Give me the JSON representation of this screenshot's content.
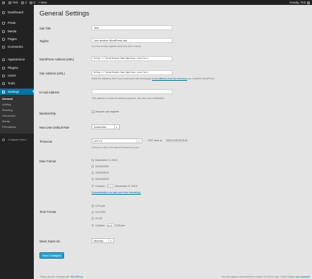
{
  "adminbar": {
    "site": "Test",
    "updates": "2",
    "comments": "0",
    "new": "+ New",
    "howdy": "Howdy, Test"
  },
  "sidebar": {
    "items": [
      {
        "label": "Dashboard",
        "icon": "dashboard-icon"
      },
      {
        "label": "Posts",
        "icon": "posts-icon"
      },
      {
        "label": "Media",
        "icon": "media-icon"
      },
      {
        "label": "Pages",
        "icon": "pages-icon"
      },
      {
        "label": "Comments",
        "icon": "comments-icon"
      },
      {
        "label": "Appearance",
        "icon": "appearance-icon"
      },
      {
        "label": "Plugins",
        "icon": "plugins-icon"
      },
      {
        "label": "Users",
        "icon": "users-icon"
      },
      {
        "label": "Tools",
        "icon": "tools-icon"
      },
      {
        "label": "Settings",
        "icon": "settings-icon"
      }
    ],
    "submenu": [
      "General",
      "Writing",
      "Reading",
      "Discussion",
      "Media",
      "Permalinks"
    ],
    "collapse": "Collapse menu"
  },
  "page": {
    "title": "General Settings",
    "site_title_label": "Site Title",
    "site_title_value": "Test",
    "tagline_label": "Tagline",
    "tagline_value": "Just another WordPress site",
    "tagline_desc": "In a few words, explain what this site is about.",
    "wp_address_label": "WordPress Address (URL)",
    "wp_address_value": "http://localhost/wordpress-svn/src",
    "site_address_label": "Site Address (URL)",
    "site_address_value": "http://localhost/wordpress-svn/src",
    "site_address_desc": "Enter the address here if you want your site homepage",
    "site_address_link": "to be different from the directory",
    "site_address_desc2": "you installed WordPress.",
    "email_label": "E-mail Address",
    "email_value": "",
    "email_desc": "This address is used for admin purposes, like new user notification.",
    "membership_label": "Membership",
    "membership_check": "Anyone can register",
    "role_label": "New User Default Role",
    "role_value": "Subscriber",
    "timezone_label": "Timezone",
    "timezone_value": "UTC+0",
    "utc_label": "UTC time is",
    "utc_value": "2013-12-09 22:23:49",
    "timezone_desc": "Choose a city in the same timezone as you.",
    "date_label": "Date Format",
    "date_options": [
      "December 9, 2013",
      "2013/12/09",
      "12/09/2013",
      "09/12/2013"
    ],
    "date_custom_label": "Custom:",
    "date_custom_value": "F j, Y",
    "date_custom_preview": "December 9, 2013",
    "date_doc_link": "Documentation on date and time formatting.",
    "time_label": "Time Format",
    "time_options": [
      "9:23 pm",
      "9:23 PM",
      "21:23"
    ],
    "time_custom_label": "Custom:",
    "time_custom_value": "g:i a",
    "time_custom_preview": "9:23 pm",
    "week_label": "Week Starts On",
    "week_value": "Monday",
    "save_button": "Save Changes"
  },
  "footer": {
    "left_text": "Thank you for creating with",
    "left_link": "WordPress.",
    "right_text": "You are using a development version (3.8-RC1-src). Cool! Please",
    "right_link": "stay updated."
  }
}
